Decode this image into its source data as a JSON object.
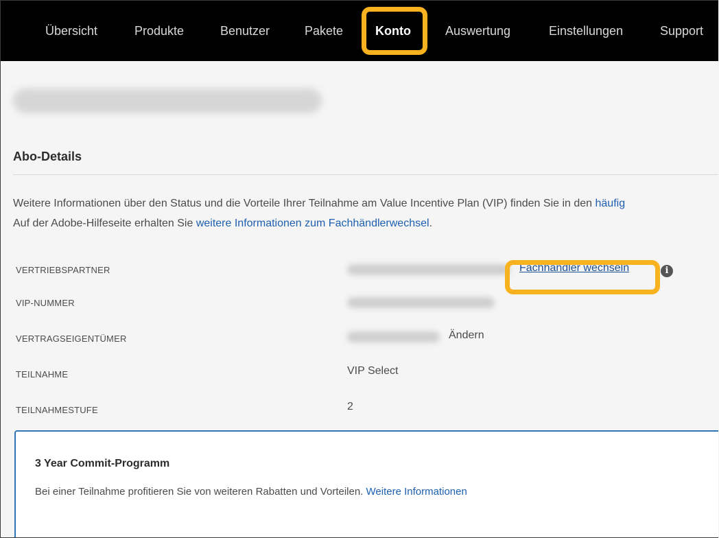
{
  "nav": {
    "items": [
      {
        "label": "Übersicht"
      },
      {
        "label": "Produkte"
      },
      {
        "label": "Benutzer"
      },
      {
        "label": "Pakete"
      },
      {
        "label": "Konto",
        "active": true
      },
      {
        "label": "Auswertung"
      },
      {
        "label": "Einstellungen"
      },
      {
        "label": "Support"
      }
    ]
  },
  "section": {
    "title": "Abo-Details",
    "intro_prefix": "Weitere Informationen über den Status und die Vorteile Ihrer Teilnahme am Value Incentive Plan (VIP) finden Sie in den ",
    "intro_link": "häufig",
    "help_prefix": "Auf der Adobe-Hilfeseite erhalten Sie ",
    "help_link": "weitere Informationen zum Fachhändlerwechsel",
    "help_suffix": "."
  },
  "details": {
    "vertriebspartner_label": "VERTRIEBSPARTNER",
    "change_dealer_link": "Fachhändler wechseln",
    "vip_number_label": "VIP-NUMMER",
    "contract_owner_label": "VERTRAGSEIGENTÜMER",
    "change_owner_link": "Ändern",
    "participation_label": "TEILNAHME",
    "participation_value": "VIP Select",
    "level_label": "TEILNAHMESTUFE",
    "level_value": "2"
  },
  "commit": {
    "title": "3 Year Commit-Programm",
    "text": "Bei einer Teilnahme profitieren Sie von weiteren Rabatten und Vorteilen. ",
    "link": "Weitere Informationen"
  },
  "colors": {
    "highlight": "#f8b11f",
    "link": "#1d5fb0",
    "nav_bg": "#000000"
  }
}
